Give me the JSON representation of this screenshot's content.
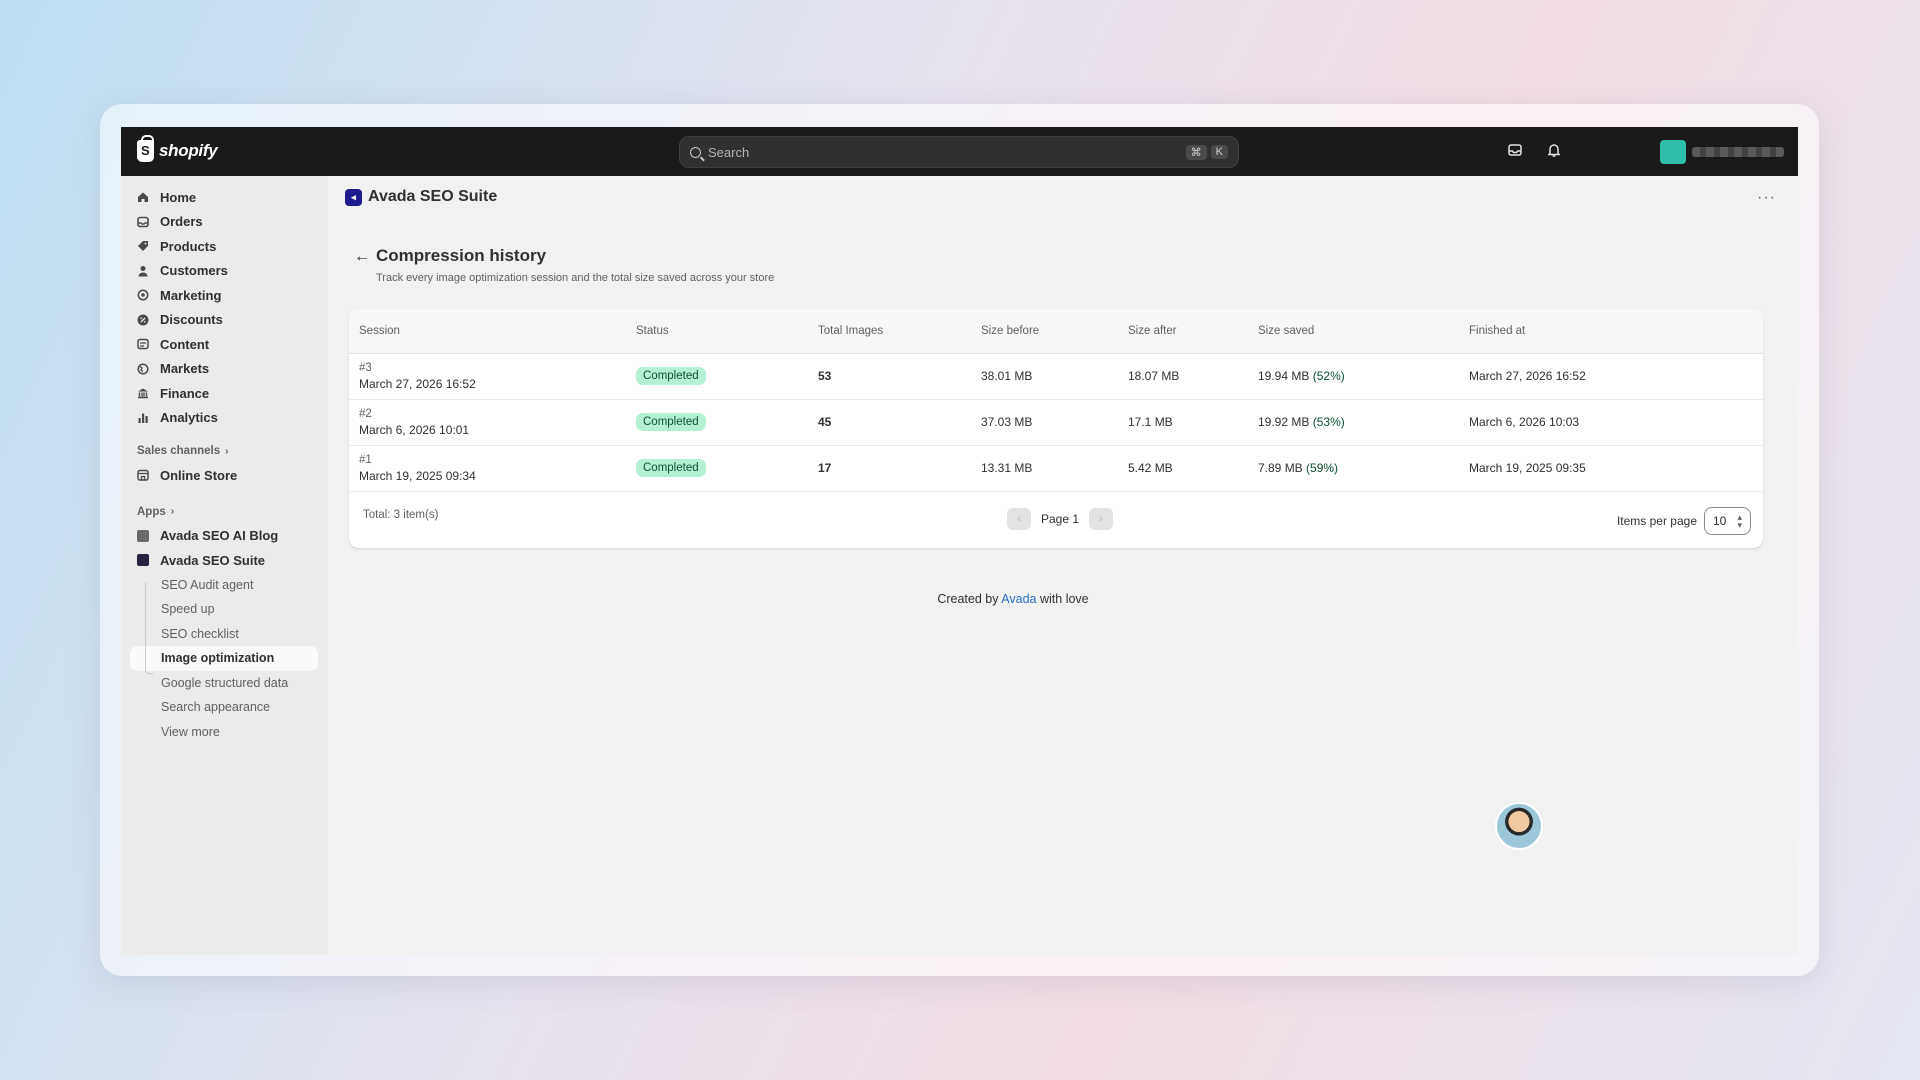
{
  "topbar": {
    "brand": "shopify",
    "search_placeholder": "Search",
    "shortcut_key1": "⌘",
    "shortcut_key2": "K"
  },
  "sidebar": {
    "items": [
      {
        "label": "Home",
        "icon": "home-icon"
      },
      {
        "label": "Orders",
        "icon": "orders-icon"
      },
      {
        "label": "Products",
        "icon": "tag-icon"
      },
      {
        "label": "Customers",
        "icon": "person-icon"
      },
      {
        "label": "Marketing",
        "icon": "target-icon"
      },
      {
        "label": "Discounts",
        "icon": "discount-icon"
      },
      {
        "label": "Content",
        "icon": "content-icon"
      },
      {
        "label": "Markets",
        "icon": "globe-icon"
      },
      {
        "label": "Finance",
        "icon": "bank-icon"
      },
      {
        "label": "Analytics",
        "icon": "bar-chart-icon"
      }
    ],
    "sales_channels_label": "Sales channels",
    "online_store": "Online Store",
    "apps_label": "Apps",
    "apps": [
      {
        "label": "Avada SEO AI Blog"
      },
      {
        "label": "Avada SEO Suite"
      }
    ],
    "sub_items": [
      {
        "label": "SEO Audit agent"
      },
      {
        "label": "Speed up"
      },
      {
        "label": "SEO checklist"
      },
      {
        "label": "Image optimization"
      },
      {
        "label": "Google structured data"
      },
      {
        "label": "Search appearance"
      },
      {
        "label": "View more"
      }
    ]
  },
  "main": {
    "app_title": "Avada SEO Suite",
    "page_title": "Compression history",
    "page_subtitle": "Track every image optimization session and the total size saved across your store",
    "table": {
      "headers": [
        "Session",
        "Status",
        "Total Images",
        "Size before",
        "Size after",
        "Size saved",
        "Finished at"
      ],
      "rows": [
        {
          "id": "#3",
          "date": "March 27, 2026 16:52",
          "status": "Completed",
          "images": "53",
          "before": "38.01 MB",
          "after": "18.07 MB",
          "saved": "19.94 MB",
          "pct": "(52%)",
          "finished": "March 27, 2026 16:52"
        },
        {
          "id": "#2",
          "date": "March 6, 2026 10:01",
          "status": "Completed",
          "images": "45",
          "before": "37.03 MB",
          "after": "17.1 MB",
          "saved": "19.92 MB",
          "pct": "(53%)",
          "finished": "March 6, 2026 10:03"
        },
        {
          "id": "#1",
          "date": "March 19, 2025 09:34",
          "status": "Completed",
          "images": "17",
          "before": "13.31 MB",
          "after": "5.42 MB",
          "saved": "7.89 MB",
          "pct": "(59%)",
          "finished": "March 19, 2025 09:35"
        }
      ]
    },
    "total_label": "Total: 3 item(s)",
    "page_label": "Page 1",
    "items_per_page_label": "Items per page",
    "items_per_page_value": "10",
    "footer_prefix": "Created by",
    "footer_link": "Avada",
    "footer_suffix": "with love"
  },
  "colors": {
    "topbar": "#1a1a1a",
    "badge_bg": "#b4f0d2",
    "badge_text": "#0c5132",
    "link": "#2c6ecb",
    "app_logo": "#1e1b8c"
  }
}
